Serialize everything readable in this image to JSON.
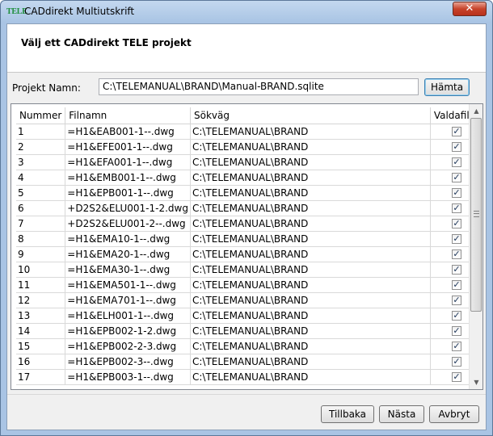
{
  "window": {
    "app_logo": "TELE",
    "title": "CADdirekt Multiutskrift",
    "close_label": "✕"
  },
  "header": {
    "title": "Välj ett CADdirekt TELE projekt"
  },
  "project": {
    "label": "Projekt Namn:",
    "value": "C:\\TELEMANUAL\\BRAND\\Manual-BRAND.sqlite",
    "fetch_button": "Hämta"
  },
  "table": {
    "columns": [
      "Nummer",
      "Filnamn",
      "Sökväg",
      "Valdafiler"
    ],
    "rows": [
      {
        "nummer": "1",
        "filnamn": "=H1&EAB001-1--.dwg",
        "sokvag": "C:\\TELEMANUAL\\BRAND",
        "checked": true
      },
      {
        "nummer": "2",
        "filnamn": "=H1&EFE001-1--.dwg",
        "sokvag": "C:\\TELEMANUAL\\BRAND",
        "checked": true
      },
      {
        "nummer": "3",
        "filnamn": "=H1&EFA001-1--.dwg",
        "sokvag": "C:\\TELEMANUAL\\BRAND",
        "checked": true
      },
      {
        "nummer": "4",
        "filnamn": "=H1&EMB001-1--.dwg",
        "sokvag": "C:\\TELEMANUAL\\BRAND",
        "checked": true
      },
      {
        "nummer": "5",
        "filnamn": "=H1&EPB001-1--.dwg",
        "sokvag": "C:\\TELEMANUAL\\BRAND",
        "checked": true
      },
      {
        "nummer": "6",
        "filnamn": "+D2S2&ELU001-1-2.dwg",
        "sokvag": "C:\\TELEMANUAL\\BRAND",
        "checked": true
      },
      {
        "nummer": "7",
        "filnamn": "+D2S2&ELU001-2--.dwg",
        "sokvag": "C:\\TELEMANUAL\\BRAND",
        "checked": true
      },
      {
        "nummer": "8",
        "filnamn": "=H1&EMA10-1--.dwg",
        "sokvag": "C:\\TELEMANUAL\\BRAND",
        "checked": true
      },
      {
        "nummer": "9",
        "filnamn": "=H1&EMA20-1--.dwg",
        "sokvag": "C:\\TELEMANUAL\\BRAND",
        "checked": true
      },
      {
        "nummer": "10",
        "filnamn": "=H1&EMA30-1--.dwg",
        "sokvag": "C:\\TELEMANUAL\\BRAND",
        "checked": true
      },
      {
        "nummer": "11",
        "filnamn": "=H1&EMA501-1--.dwg",
        "sokvag": "C:\\TELEMANUAL\\BRAND",
        "checked": true
      },
      {
        "nummer": "12",
        "filnamn": "=H1&EMA701-1--.dwg",
        "sokvag": "C:\\TELEMANUAL\\BRAND",
        "checked": true
      },
      {
        "nummer": "13",
        "filnamn": "=H1&ELH001-1--.dwg",
        "sokvag": "C:\\TELEMANUAL\\BRAND",
        "checked": true
      },
      {
        "nummer": "14",
        "filnamn": "=H1&EPB002-1-2.dwg",
        "sokvag": "C:\\TELEMANUAL\\BRAND",
        "checked": true
      },
      {
        "nummer": "15",
        "filnamn": "=H1&EPB002-2-3.dwg",
        "sokvag": "C:\\TELEMANUAL\\BRAND",
        "checked": true
      },
      {
        "nummer": "16",
        "filnamn": "=H1&EPB002-3--.dwg",
        "sokvag": "C:\\TELEMANUAL\\BRAND",
        "checked": true
      },
      {
        "nummer": "17",
        "filnamn": "=H1&EPB003-1--.dwg",
        "sokvag": "C:\\TELEMANUAL\\BRAND",
        "checked": true
      }
    ]
  },
  "footer": {
    "back_label": "Tillbaka",
    "next_label": "Nästa",
    "cancel_label": "Avbryt"
  },
  "colors": {
    "titlebar": "#a9c4e4",
    "logo": "#1d8d3b",
    "close_button": "#c7432b"
  }
}
